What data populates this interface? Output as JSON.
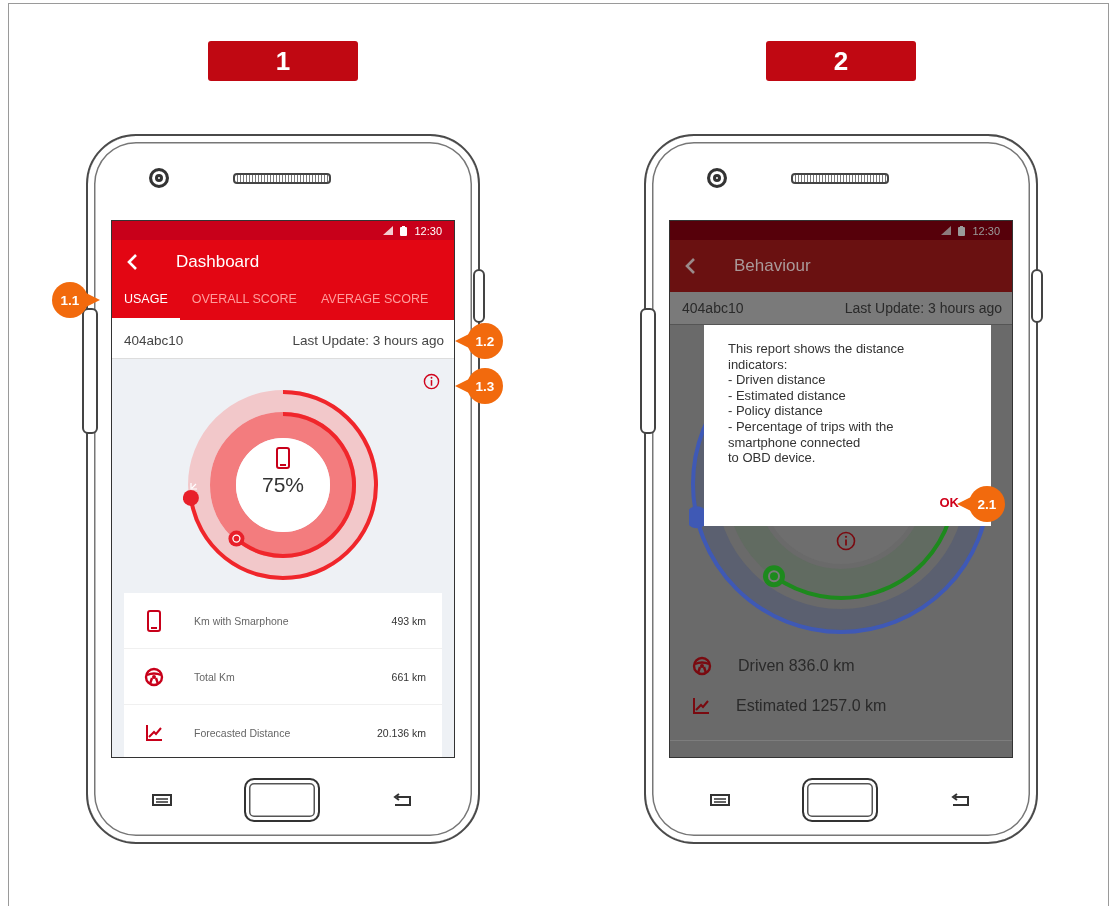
{
  "panels": [
    {
      "kind": "dashboard",
      "number": "1",
      "status_time": "12:30",
      "title": "Dashboard",
      "tabs": [
        {
          "label": "USAGE",
          "selected": true
        },
        {
          "label": "OVERALL SCORE",
          "selected": false
        },
        {
          "label": "AVERAGE SCORE",
          "selected": false
        }
      ],
      "vehicle_id": "404abc10",
      "last_update": "Last Update: 3 hours ago",
      "gauge_value": "75%",
      "stats": [
        {
          "kind": "smartphone",
          "label": "Km with Smarphone",
          "value": "493 km"
        },
        {
          "kind": "steering",
          "label": "Total Km",
          "value": "661 km"
        },
        {
          "kind": "trend",
          "label": "Forecasted Distance",
          "value": "20.136 km"
        }
      ],
      "callouts": [
        {
          "label": "1.1"
        },
        {
          "label": "1.2"
        },
        {
          "label": "1.3"
        }
      ]
    },
    {
      "kind": "report_dialog",
      "number": "2",
      "status_time": "12:30",
      "title": "Behaviour",
      "vehicle_id": "404abc10",
      "last_update": "Last Update: 3 hours ago",
      "legend": [
        {
          "kind": "steering",
          "label": "Driven 836.0 km"
        },
        {
          "kind": "trend",
          "label": "Estimated 1257.0 km"
        }
      ],
      "dialog": {
        "text": "This report shows the distance\nindicators:\n- Driven distance\n- Estimated distance\n- Policy distance\n- Percentage of trips with the\nsmartphone connected\nto OBD device.",
        "button": "OK"
      },
      "callouts": [
        {
          "label": "2.1"
        }
      ]
    }
  ]
}
